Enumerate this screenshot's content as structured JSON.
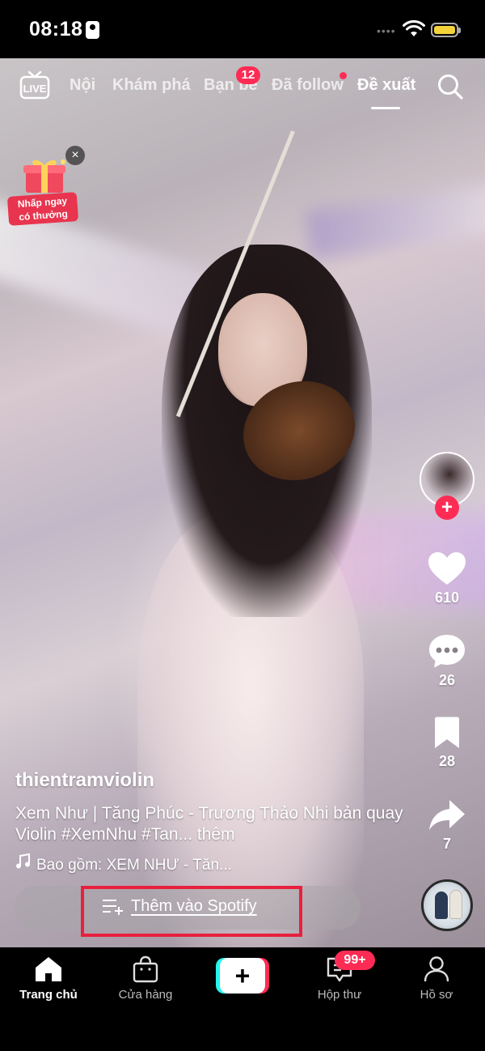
{
  "status_bar": {
    "time": "08:18"
  },
  "top_nav": {
    "tabs": [
      {
        "label": "Nội"
      },
      {
        "label": "Khám phá"
      },
      {
        "label": "Bạn bè"
      },
      {
        "label": "Đã follow"
      },
      {
        "label": "Đề xuất",
        "active": true
      }
    ],
    "friends_badge": "12",
    "live_icon": "live-tv-icon",
    "search_icon": "search-icon"
  },
  "reward_widget": {
    "label_line1": "Nhấp ngay",
    "label_line2": "có thưởng",
    "close": "×"
  },
  "actions": {
    "likes": "610",
    "comments": "26",
    "saves": "28",
    "shares": "7",
    "follow": "+"
  },
  "video": {
    "username": "thientramviolin",
    "description": "Xem Như | Tăng Phúc - Trương Thảo Nhi bản quay Violin  #XemNhu #Tan...",
    "more": " thêm",
    "sound": "Bao gồm: XEM NHƯ - Tăn..."
  },
  "spotify": {
    "label": "Thêm vào Spotify"
  },
  "bottom_nav": {
    "items": [
      {
        "label": "Trang chủ",
        "icon": "home-icon",
        "active": true
      },
      {
        "label": "Cửa hàng",
        "icon": "shop-bag-icon"
      },
      {
        "label": "+",
        "icon": "create-plus-icon"
      },
      {
        "label": "Hộp thư",
        "icon": "inbox-icon"
      },
      {
        "label": "Hồ sơ",
        "icon": "profile-icon"
      }
    ],
    "inbox_badge": "99+"
  },
  "colors": {
    "accent": "#fe2c55",
    "cyan": "#25f4ee",
    "highlight_box": "#e8203d",
    "battery": "#f3d33a"
  }
}
